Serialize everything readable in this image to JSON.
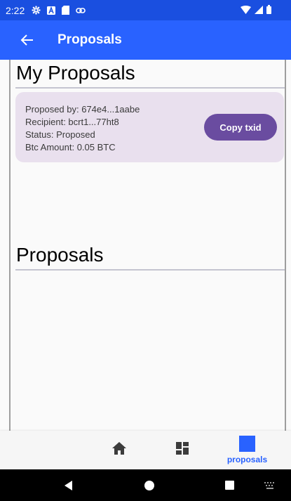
{
  "status_bar": {
    "time": "2:22",
    "icons": [
      "gear-icon",
      "a-badge-icon",
      "sd-card-icon",
      "link-icon"
    ],
    "right_icons": [
      "wifi-icon",
      "signal-icon",
      "battery-icon"
    ]
  },
  "app_bar": {
    "back_icon": "arrow-back-icon",
    "title": "Proposals"
  },
  "my_proposals": {
    "heading": "My Proposals",
    "items": [
      {
        "proposed_by": "Proposed by: 674e4...1aabe",
        "recipient": "Recipient: bcrt1...77ht8",
        "status": "Status: Proposed",
        "amount": "Btc Amount: 0.05 BTC",
        "copy_label": "Copy txid"
      }
    ]
  },
  "proposals": {
    "heading": "Proposals",
    "items": []
  },
  "bottom_nav": {
    "items": [
      {
        "icon": "home-icon",
        "label": ""
      },
      {
        "icon": "dashboard-icon",
        "label": ""
      },
      {
        "icon": "square-icon",
        "label": "proposals",
        "active": true
      }
    ],
    "active_color": "#2962ff"
  },
  "colors": {
    "status_bar": "#1a4fe0",
    "app_bar": "#2962ff",
    "card": "#e9e0ee",
    "copy_button": "#6a4ca0"
  }
}
